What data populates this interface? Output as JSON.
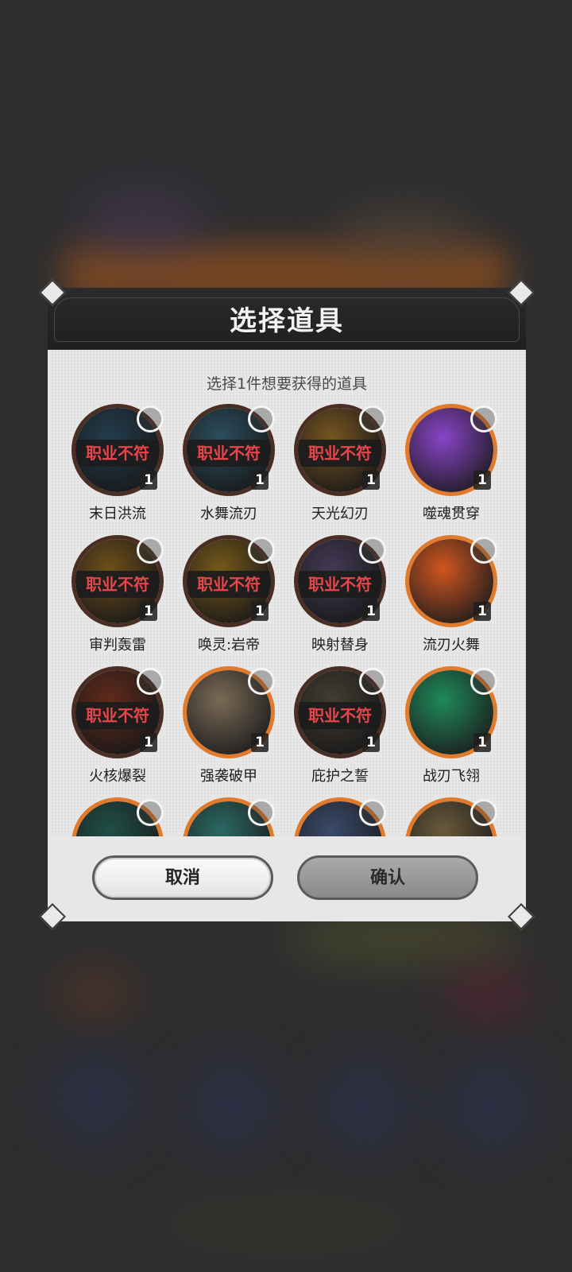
{
  "modal": {
    "title": "选择道具",
    "subtitle": "选择1件想要获得的道具",
    "mismatch_label": "职业不符",
    "items": [
      {
        "name": "末日洪流",
        "count": "1",
        "mismatch": true,
        "theme": "#2f5f7a"
      },
      {
        "name": "水舞流刃",
        "count": "1",
        "mismatch": true,
        "theme": "#3f7e9a"
      },
      {
        "name": "天光幻刃",
        "count": "1",
        "mismatch": true,
        "theme": "#c98a2a"
      },
      {
        "name": "噬魂贯穿",
        "count": "1",
        "mismatch": false,
        "theme": "#8a44c8"
      },
      {
        "name": "审判轰雷",
        "count": "1",
        "mismatch": true,
        "theme": "#b8801f"
      },
      {
        "name": "唤灵:岩帝",
        "count": "1",
        "mismatch": true,
        "theme": "#c6921f"
      },
      {
        "name": "映射替身",
        "count": "1",
        "mismatch": true,
        "theme": "#6a5a8a"
      },
      {
        "name": "流刃火舞",
        "count": "1",
        "mismatch": false,
        "theme": "#d0561e"
      },
      {
        "name": "火核爆裂",
        "count": "1",
        "mismatch": true,
        "theme": "#a03d20"
      },
      {
        "name": "强袭破甲",
        "count": "1",
        "mismatch": false,
        "theme": "#7a6a55"
      },
      {
        "name": "庇护之誓",
        "count": "1",
        "mismatch": true,
        "theme": "#6a5e4a"
      },
      {
        "name": "战刃飞翎",
        "count": "1",
        "mismatch": false,
        "theme": "#1f8a5a"
      },
      {
        "name": "",
        "count": "",
        "mismatch": false,
        "theme": "#1f4f46"
      },
      {
        "name": "",
        "count": "",
        "mismatch": false,
        "theme": "#2a6a64"
      },
      {
        "name": "",
        "count": "",
        "mismatch": false,
        "theme": "#3a4a6a"
      },
      {
        "name": "",
        "count": "",
        "mismatch": false,
        "theme": "#6a5a3a"
      }
    ],
    "buttons": {
      "cancel": "取消",
      "confirm": "确认"
    }
  }
}
